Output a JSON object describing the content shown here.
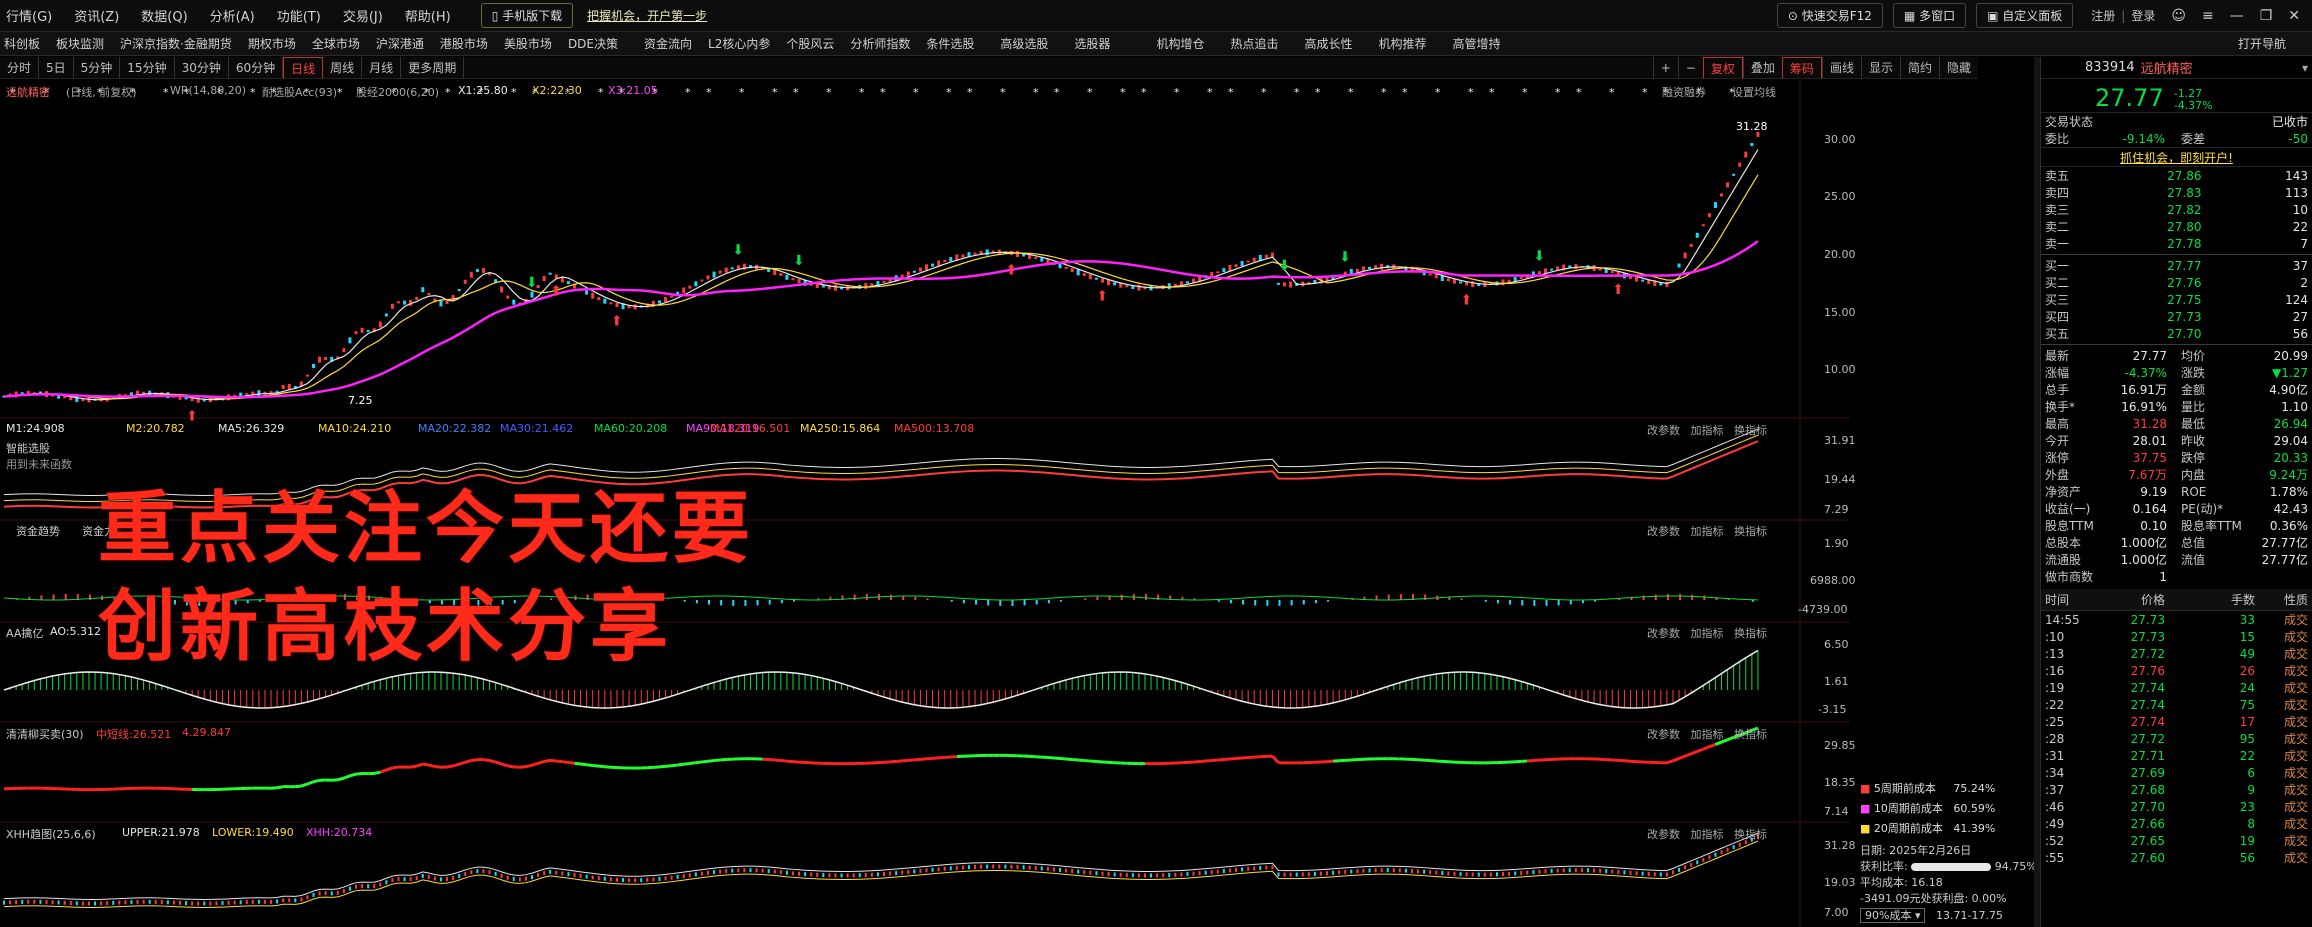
{
  "menu": [
    "行情(G)",
    "资讯(Z)",
    "数据(Q)",
    "分析(A)",
    "功能(T)",
    "交易(J)",
    "帮助(H)"
  ],
  "promo": {
    "download": "手机版下载",
    "link": "把握机会，开户第一步"
  },
  "top_right": {
    "quick_trade": "快速交易F12",
    "multi_window": "多窗口",
    "custom_panel": "自定义面板",
    "register": "注册",
    "login": "登录"
  },
  "nav": [
    "科创板",
    "板块监测",
    "沪深京指数·金融期货",
    "期权市场",
    "全球市场",
    "沪深港通",
    "港股市场",
    "美股市场",
    "DDE决策",
    "资金流向",
    "L2核心内参",
    "个股风云",
    "分析师指数",
    "条件选股",
    "高级选股",
    "选股器",
    "机构增仓",
    "热点追击",
    "高成长性",
    "机构推荐",
    "高管增持",
    "打开导航"
  ],
  "periods": [
    "分时",
    "5日",
    "5分钟",
    "15分钟",
    "30分钟",
    "60分钟",
    "日线",
    "周线",
    "月线",
    "更多周期"
  ],
  "active_period": "日线",
  "chart_tools": [
    "复权",
    "叠加",
    "筹码",
    "画线",
    "显示",
    "简约",
    "隐藏"
  ],
  "main_header": {
    "name": "远航精密",
    "mode": "(日线, 前复权)",
    "wr": "WR(14,80,20)",
    "ind1": "耐选股Acc(93)",
    "ind2": "股经2000(6,20)",
    "x1": "X1:25.80",
    "x2": "X2:22.30",
    "x3": "X3:21.05",
    "margin_trade": "融资融券",
    "settings": "设置均线"
  },
  "ma_line": [
    "M1:24.908",
    "M2:20.782",
    "MA5:26.329",
    "MA10:24.210",
    "MA20:22.382",
    "MA30:21.462",
    "MA60:20.208",
    "MA90:18.319",
    "MA120:16.501",
    "MA250:15.864",
    "MA500:13.708"
  ],
  "price_axis": [
    "30.00",
    "25.00",
    "20.00",
    "15.00",
    "10.00"
  ],
  "high_label": "31.28",
  "low_label": "7.25",
  "panels": [
    {
      "title": "智能选股",
      "sub": "用到未来函数",
      "axis": [
        "31.91",
        "19.44",
        "7.29"
      ]
    },
    {
      "title": "资金趋势",
      "sub": "资金力",
      "axis": [
        "1.90",
        "6988.00",
        "-4739.00"
      ]
    },
    {
      "title": "AA擒亿",
      "sub": "AO:5.312",
      "axis": [
        "6.50",
        "1.61",
        "-3.15"
      ]
    },
    {
      "title": "清清柳买卖(30)",
      "sub": "中短线:26.521",
      "sub2": "4.29.847",
      "axis": [
        "29.85",
        "18.35",
        "7.14"
      ]
    },
    {
      "title": "XHH趋图(25,6,6)",
      "sub": "UPPER:21.978",
      "sub2": "LOWER:19.490",
      "sub3": "XHH:20.734",
      "axis": [
        "31.28",
        "19.03",
        "7.00"
      ]
    }
  ],
  "panel_tools": [
    "改参数",
    "加指标",
    "换指标"
  ],
  "overlay_text": [
    "重点关注今天还要",
    "创新高枝术分享"
  ],
  "chip": {
    "rows": [
      {
        "label": "5周期前成本",
        "value": "75.24%"
      },
      {
        "label": "10周期前成本",
        "value": "60.59%"
      },
      {
        "label": "20周期前成本",
        "value": "41.39%"
      }
    ],
    "date": "日期: 2025年2月26日",
    "profit_ratio_label": "获利比率:",
    "profit_ratio": "94.75%",
    "avg_cost": "平均成本: 16.18",
    "profit_line": "-3491.09元处获利盘: 0.00%",
    "cost_mode": "90%成本",
    "cost_range": "13.71-17.75"
  },
  "quote": {
    "code": "833914",
    "name": "远航精密",
    "price": "27.77",
    "change": "-1.27",
    "pct": "-4.37%",
    "status_label": "交易状态",
    "status": "已收市",
    "wei_bi_label": "委比",
    "wei_bi": "-9.14%",
    "wei_cha_label": "委差",
    "wei_cha": "-50",
    "banner": "抓住机会，即刻开户!",
    "asks": [
      {
        "l": "卖五",
        "p": "27.86",
        "v": "143"
      },
      {
        "l": "卖四",
        "p": "27.83",
        "v": "113"
      },
      {
        "l": "卖三",
        "p": "27.82",
        "v": "10"
      },
      {
        "l": "卖二",
        "p": "27.80",
        "v": "22"
      },
      {
        "l": "卖一",
        "p": "27.78",
        "v": "7"
      }
    ],
    "bids": [
      {
        "l": "买一",
        "p": "27.77",
        "v": "37"
      },
      {
        "l": "买二",
        "p": "27.76",
        "v": "2"
      },
      {
        "l": "买三",
        "p": "27.75",
        "v": "124"
      },
      {
        "l": "买四",
        "p": "27.73",
        "v": "27"
      },
      {
        "l": "买五",
        "p": "27.70",
        "v": "56"
      }
    ],
    "stats": [
      [
        "最新",
        "27.77",
        "均价",
        "20.99"
      ],
      [
        "涨幅",
        "-4.37%",
        "涨跌",
        "▼1.27"
      ],
      [
        "总手",
        "16.91万",
        "金额",
        "4.90亿"
      ],
      [
        "换手*",
        "16.91%",
        "量比",
        "1.10"
      ],
      [
        "最高",
        "31.28",
        "最低",
        "26.94"
      ],
      [
        "今开",
        "28.01",
        "昨收",
        "29.04"
      ],
      [
        "涨停",
        "37.75",
        "跌停",
        "20.33"
      ],
      [
        "外盘",
        "7.67万",
        "内盘",
        "9.24万"
      ],
      [
        "净资产",
        "9.19",
        "ROE",
        "1.78%"
      ],
      [
        "收益(一)",
        "0.164",
        "PE(动)*",
        "42.43"
      ],
      [
        "股息TTM",
        "0.10",
        "股息率TTM",
        "0.36%"
      ],
      [
        "总股本",
        "1.000亿",
        "总值",
        "27.77亿"
      ],
      [
        "流通股",
        "1.000亿",
        "流值",
        "27.77亿"
      ],
      [
        "做市商数",
        "1",
        "",
        ""
      ]
    ],
    "ticks_header": [
      "时间",
      "价格",
      "手数",
      "性质"
    ],
    "ticks": [
      [
        "14:55",
        "27.73",
        "33",
        "成交"
      ],
      [
        ":10",
        "27.73",
        "15",
        "成交"
      ],
      [
        ":13",
        "27.72",
        "49",
        "成交"
      ],
      [
        ":16",
        "27.76",
        "26",
        "成交"
      ],
      [
        ":19",
        "27.74",
        "24",
        "成交"
      ],
      [
        ":22",
        "27.74",
        "75",
        "成交"
      ],
      [
        ":25",
        "27.74",
        "17",
        "成交"
      ],
      [
        ":28",
        "27.72",
        "95",
        "成交"
      ],
      [
        ":31",
        "27.71",
        "22",
        "成交"
      ],
      [
        ":34",
        "27.69",
        "6",
        "成交"
      ],
      [
        ":37",
        "27.68",
        "9",
        "成交"
      ],
      [
        ":46",
        "27.70",
        "23",
        "成交"
      ],
      [
        ":49",
        "27.66",
        "8",
        "成交"
      ],
      [
        ":52",
        "27.65",
        "19",
        "成交"
      ],
      [
        ":55",
        "27.60",
        "56",
        "成交"
      ]
    ]
  },
  "colors": {
    "up": "#ff3b3b",
    "down": "#00e040",
    "ma_magenta": "#ff20ff",
    "ma_yellow": "#ffdd33",
    "ma_white": "#e6e6e6",
    "cyan": "#40e0ff"
  }
}
